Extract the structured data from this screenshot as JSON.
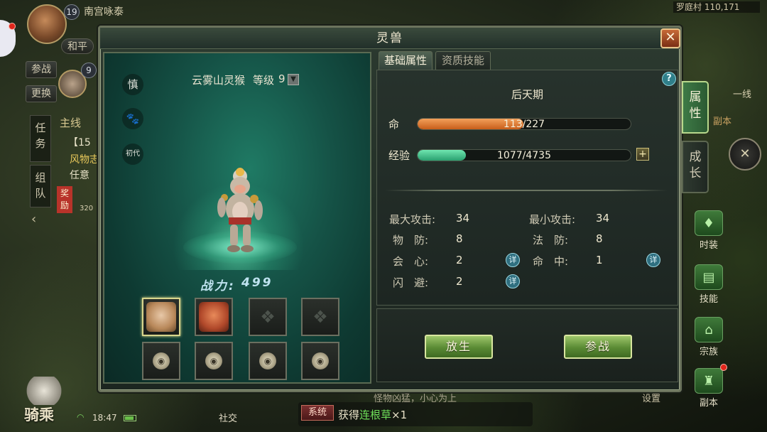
{
  "panel": {
    "title": "灵兽"
  },
  "hud": {
    "player_level": "19",
    "player_name": "南宫咏泰",
    "mode": "和平",
    "pet_level": "9",
    "btn_fight": "参战",
    "btn_switch": "更换",
    "tab_quest": "任务",
    "tab_team": "组队",
    "quest_main": "主线",
    "quest_item": "【15",
    "quest_desc1": "风物志",
    "quest_desc2": "任意",
    "reward_tag": "奖励",
    "reward_count": "320",
    "map_info": "罗庭村 110,171",
    "line": "一线",
    "dungeon_hint": "副本",
    "time": "18:47",
    "mount": "骑乘",
    "social": "社交",
    "chat_hint": "怪物凶猛，小心为上",
    "settings": "设置"
  },
  "pet": {
    "name": "云雾山灵猴",
    "level_label": "等级",
    "level": "9",
    "side_icons": [
      "慎",
      "🐾",
      "初代"
    ],
    "power_label": "战力:",
    "power_value": "499"
  },
  "tabs": {
    "basic": "基础属性",
    "skills": "资质技能"
  },
  "stats": {
    "stage": "后天期",
    "hp_label": "命",
    "hp_current": 113,
    "hp_max": 227,
    "hp_text": "113/227",
    "exp_label": "经验",
    "exp_current": 1077,
    "exp_max": 4735,
    "exp_text": "1077/4735",
    "rows": [
      {
        "label": "最大攻击:",
        "value": "34"
      },
      {
        "label": "最小攻击:",
        "value": "34"
      },
      {
        "label": "物　防:",
        "value": "8"
      },
      {
        "label": "法　防:",
        "value": "8"
      },
      {
        "label": "会　心:",
        "value": "2"
      },
      {
        "label": "命　中:",
        "value": "1"
      },
      {
        "label": "闪　避:",
        "value": "2"
      }
    ],
    "detail_label": "详"
  },
  "actions": {
    "release": "放生",
    "fight": "参战"
  },
  "side_tabs": {
    "attr": "属性",
    "growth": "成长"
  },
  "right_menu": [
    "时装",
    "技能",
    "宗族",
    "副本"
  ],
  "chat": {
    "tag": "系统",
    "text_prefix": "获得",
    "item": "连根草",
    "qty": "×1"
  },
  "colors": {
    "hp_fill": "#e07a2c",
    "exp_fill": "#3fc58a",
    "accent_green": "#9ec66a"
  }
}
